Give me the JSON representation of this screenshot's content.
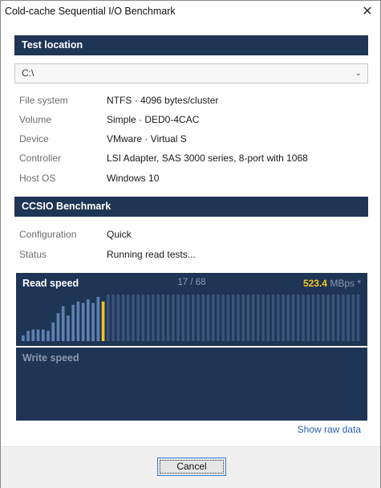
{
  "window": {
    "title": "Cold-cache Sequential I/O Benchmark",
    "close_glyph": "✕"
  },
  "test_location": {
    "header": "Test location",
    "drive_selected": "C:\\",
    "dropdown_arrow": "⌄",
    "rows": [
      {
        "label": "File system",
        "value": "NTFS  ·  4096 bytes/cluster"
      },
      {
        "label": "Volume",
        "value": "Simple  ·  DED0-4CAC"
      },
      {
        "label": "Device",
        "value": "VMware  ·  Virtual S"
      },
      {
        "label": "Controller",
        "value": "LSI Adapter, SAS 3000 series, 8-port with 1068"
      },
      {
        "label": "Host OS",
        "value": "Windows 10"
      }
    ]
  },
  "benchmark": {
    "header": "CCSIO Benchmark",
    "rows": [
      {
        "label": "Configuration",
        "value": "Quick"
      },
      {
        "label": "Status",
        "value": "Running read tests..."
      }
    ]
  },
  "read_graph": {
    "title": "Read speed",
    "progress": "17 / 68",
    "progress_done": 17,
    "progress_total": 68,
    "speed_value": "523.4",
    "speed_unit": " MBps *",
    "bars_relative": [
      0.12,
      0.22,
      0.25,
      0.25,
      0.25,
      0.22,
      0.4,
      0.6,
      0.75,
      0.55,
      0.78,
      0.85,
      0.82,
      0.9,
      0.82,
      0.95,
      0.85
    ]
  },
  "write_graph": {
    "title": "Write speed"
  },
  "colors": {
    "panel": "#1f3556",
    "bar_done": "#5d82b0",
    "bar_current": "#f2c51c",
    "bar_empty": "#3a5379"
  },
  "footer": {
    "raw_data_link": "Show raw data",
    "cancel_label": "Cancel"
  }
}
